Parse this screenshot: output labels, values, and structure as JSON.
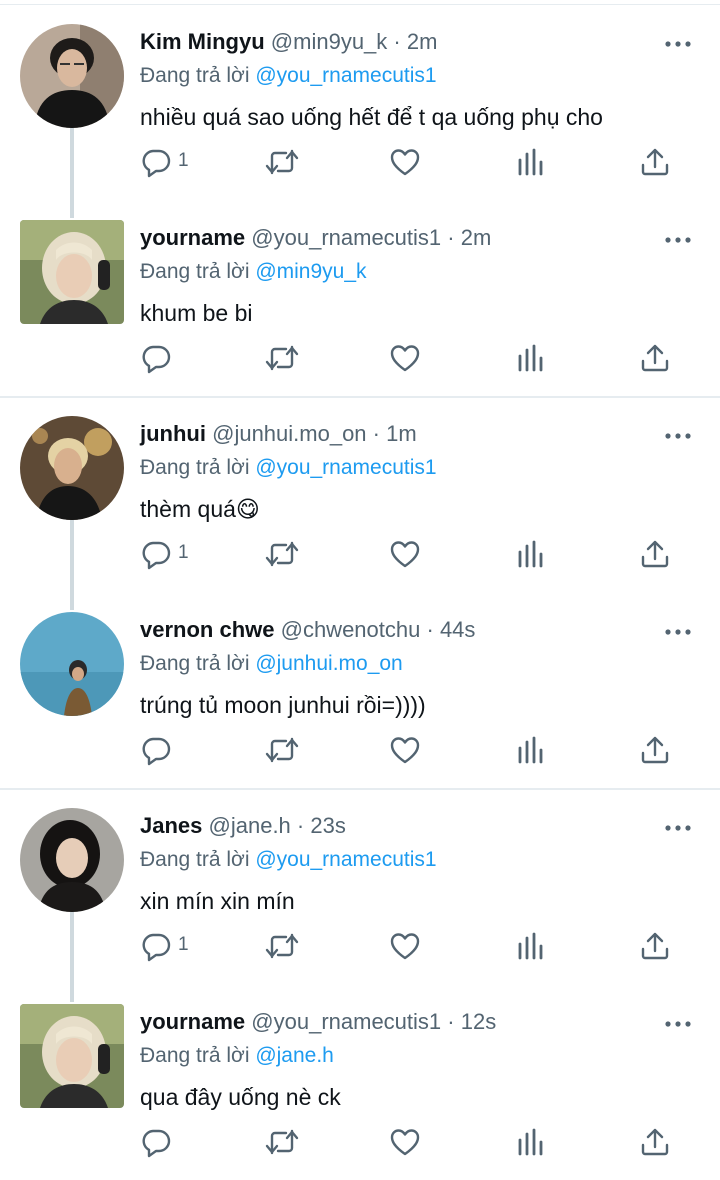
{
  "icons": {
    "reply": "reply-icon",
    "retweet": "retweet-icon",
    "like": "heart-icon",
    "views": "analytics-icon",
    "share": "share-icon",
    "more": "more-icon"
  },
  "colors": {
    "text": "#0f1419",
    "secondary": "#536471",
    "accent": "#1d9bf0",
    "divider": "#e6ecf0",
    "thread_line": "#cfd9de"
  },
  "tweets": [
    {
      "name": "Kim Mingyu",
      "handle": "@min9yu_k",
      "time": "2m",
      "reply_prefix": "Đang trả lời",
      "reply_to": "@you_rnamecutis1",
      "text": "nhiều quá sao uống hết để t qa uống phụ cho",
      "reply_count": "1"
    },
    {
      "name": "yourname",
      "handle": "@you_rnamecutis1",
      "time": "2m",
      "reply_prefix": "Đang trả lời",
      "reply_to": "@min9yu_k",
      "text": "khum be bi",
      "reply_count": ""
    },
    {
      "name": "junhui",
      "handle": "@junhui.mo_on",
      "time": "1m",
      "reply_prefix": "Đang trả lời",
      "reply_to": "@you_rnamecutis1",
      "text": "thèm quá😋",
      "reply_count": "1"
    },
    {
      "name": "vernon chwe",
      "handle": "@chwenotchu",
      "time": "44s",
      "reply_prefix": "Đang trả lời",
      "reply_to": "@junhui.mo_on",
      "text": "trúng tủ moon junhui rồi=))))",
      "reply_count": ""
    },
    {
      "name": "Janes",
      "handle": "@jane.h",
      "time": "23s",
      "reply_prefix": "Đang trả lời",
      "reply_to": "@you_rnamecutis1",
      "text": "xin mín xin mín",
      "reply_count": "1"
    },
    {
      "name": "yourname",
      "handle": "@you_rnamecutis1",
      "time": "12s",
      "reply_prefix": "Đang trả lời",
      "reply_to": "@jane.h",
      "text": "qua đây uống nè ck",
      "reply_count": ""
    }
  ]
}
